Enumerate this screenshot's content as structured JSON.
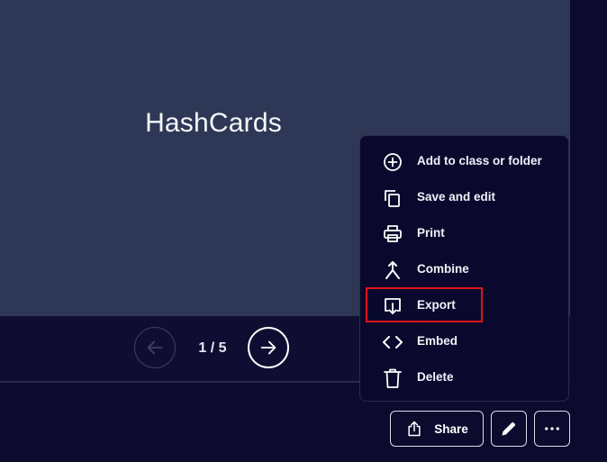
{
  "card": {
    "title": "HashCards"
  },
  "navigation": {
    "counter": "1 / 5",
    "prev_icon": "arrow-left-icon",
    "next_icon": "arrow-right-icon"
  },
  "menu": {
    "items": [
      {
        "label": "Add to class or folder",
        "icon": "plus-circle-icon"
      },
      {
        "label": "Save and edit",
        "icon": "copy-icon"
      },
      {
        "label": "Print",
        "icon": "printer-icon"
      },
      {
        "label": "Combine",
        "icon": "merge-icon"
      },
      {
        "label": "Export",
        "icon": "export-icon"
      },
      {
        "label": "Embed",
        "icon": "code-icon"
      },
      {
        "label": "Delete",
        "icon": "trash-icon"
      }
    ],
    "highlighted_item": "Export",
    "highlight_color": "#e0141a"
  },
  "toolbar": {
    "share_label": "Share",
    "share_icon": "share-icon",
    "edit_icon": "pencil-icon",
    "more_icon": "more-horizontal-icon"
  },
  "colors": {
    "background": "#0c0b2e",
    "card": "#2e3856",
    "menu": "#0a092d"
  }
}
